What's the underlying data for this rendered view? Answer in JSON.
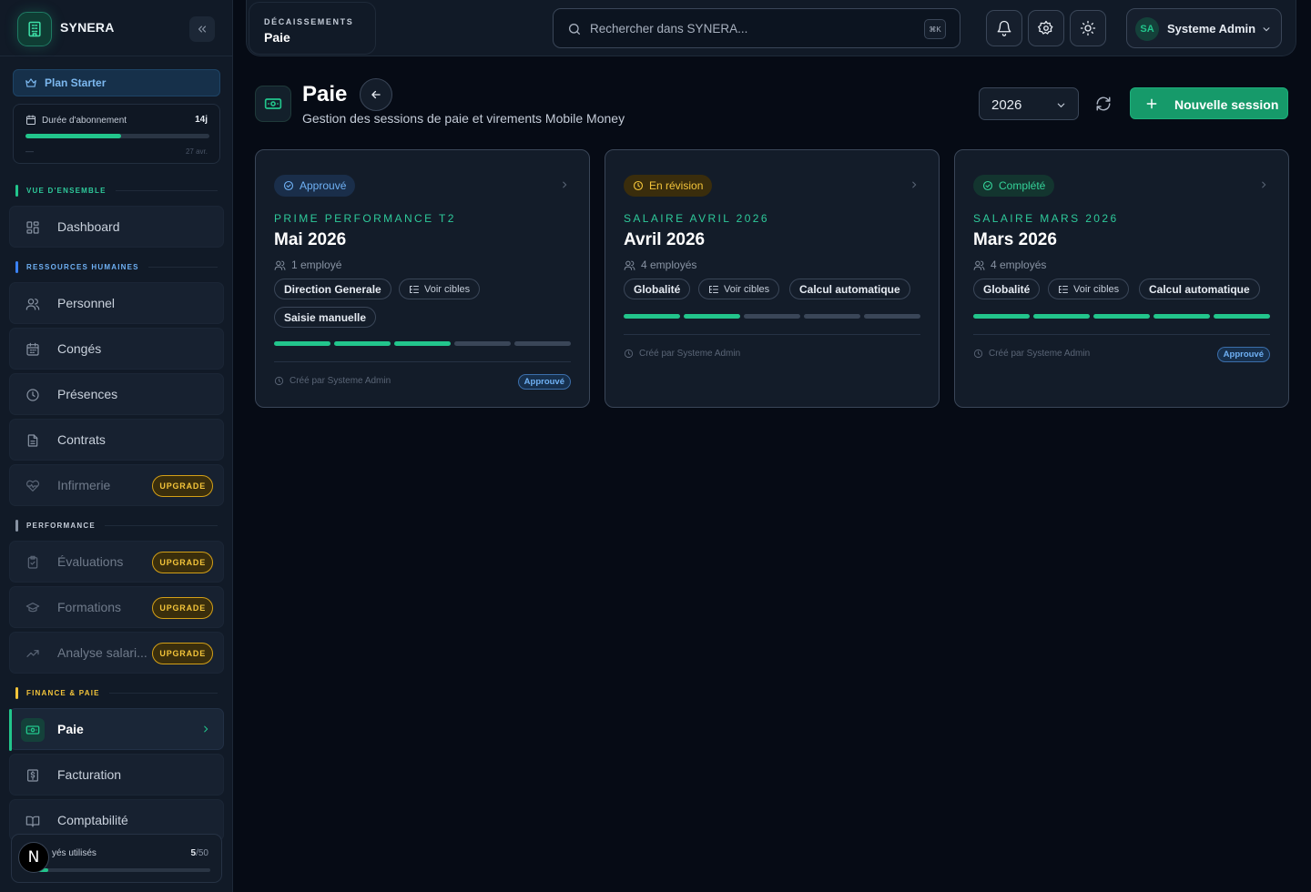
{
  "brand": {
    "name": "SYNERA"
  },
  "plan": {
    "label": "Plan Starter"
  },
  "subscription": {
    "label": "Durée d'abonnement",
    "days": "14j",
    "progress": 0.52,
    "dash": "—",
    "end_date": "27 avr."
  },
  "sections": {
    "overview": "VUE D'ENSEMBLE",
    "hr": "RESSOURCES HUMAINES",
    "performance": "PERFORMANCE",
    "finance": "FINANCE & PAIE"
  },
  "nav": {
    "dashboard": "Dashboard",
    "personnel": "Personnel",
    "conges": "Congés",
    "presences": "Présences",
    "contrats": "Contrats",
    "infirmerie": "Infirmerie",
    "evaluations": "Évaluations",
    "formations": "Formations",
    "analyse": "Analyse salari...",
    "paie": "Paie",
    "facturation": "Facturation",
    "comptabilite": "Comptabilité",
    "upgrade_label": "UPGRADE"
  },
  "usage": {
    "label": "yés utilisés",
    "used": "5",
    "total": "/50",
    "progress": 0.1
  },
  "badge_letter": "N",
  "topbar": {
    "crumb_parent": "DÉCAISSEMENTS",
    "crumb_current": "Paie",
    "search_placeholder": "Rechercher dans SYNERA...",
    "search_shortcut": "⌘K",
    "user_initials": "SA",
    "user_name": "Systeme Admin"
  },
  "page": {
    "title": "Paie",
    "subtitle": "Gestion des sessions de paie et virements Mobile Money",
    "year": "2026",
    "new_session": "Nouvelle session"
  },
  "cards": [
    {
      "status": "Approuvé",
      "eyebrow": "PRIME PERFORMANCE T2",
      "title": "Mai 2026",
      "employees": "1 employé",
      "chip_scope": "Direction Generale",
      "chip_targets": "Voir cibles",
      "chip_mode": "Saisie manuelle",
      "steps_done": 3,
      "steps_total": 5,
      "creator": "Créé par Systeme Admin",
      "footer_badge": "Approuvé"
    },
    {
      "status": "En révision",
      "eyebrow": "SALAIRE AVRIL 2026",
      "title": "Avril 2026",
      "employees": "4 employés",
      "chip_scope": "Globalité",
      "chip_targets": "Voir cibles",
      "chip_mode": "Calcul automatique",
      "steps_done": 2,
      "steps_total": 5,
      "creator": "Créé par Systeme Admin"
    },
    {
      "status": "Complété",
      "eyebrow": "SALAIRE MARS 2026",
      "title": "Mars 2026",
      "employees": "4 employés",
      "chip_scope": "Globalité",
      "chip_targets": "Voir cibles",
      "chip_mode": "Calcul automatique",
      "steps_done": 5,
      "steps_total": 5,
      "creator": "Créé par Systeme Admin",
      "footer_badge": "Approuvé"
    }
  ],
  "colors": {
    "accent": "#22c58c",
    "blue": "#6fb1f5",
    "amber": "#f3c43a",
    "overview_mark": "#22c58c",
    "hr_mark": "#3b82f6",
    "performance_mark": "#8893a3",
    "finance_mark": "#f3c43a"
  },
  "icons": {
    "brand": "building-icon",
    "collapse": "chevrons-left-icon",
    "search": "search-icon",
    "notifications": "bell-icon",
    "settings": "gear-icon",
    "theme": "sun-icon",
    "back": "arrow-left-icon",
    "refresh": "refresh-icon",
    "add": "plus-icon"
  }
}
